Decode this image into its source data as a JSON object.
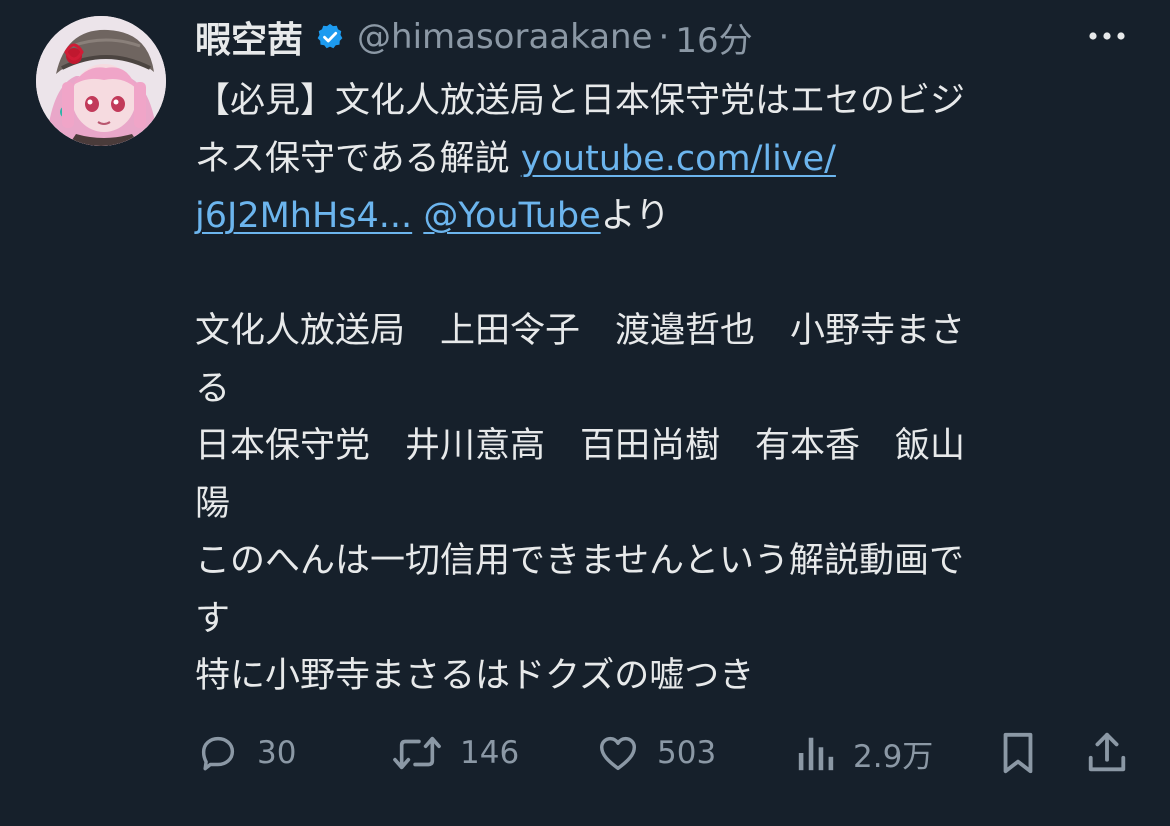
{
  "author": {
    "display_name": "暇空茜",
    "handle": "@himasoraakane",
    "separator": "·",
    "time": "16分",
    "verified_icon": "verified-badge-icon",
    "avatar": "avatar-image"
  },
  "tweet": {
    "line1": "【必見】文化人放送局と日本保守党はエセのビジ",
    "line2_text": "ネス保守である解説 ",
    "link1_part1": "youtube.com/live/",
    "link1_part2": "j6J2MhHs4...",
    "mention": "@YouTube",
    "line3_suffix": "より",
    "line4": "文化人放送局　上田令子　渡邉哲也　小野寺まさ",
    "line5": "る",
    "line6": "日本保守党　井川意高　百田尚樹　有本香　飯山",
    "line7": "陽",
    "line8": "このへんは一切信用できませんという解説動画で",
    "line9": "す",
    "line10": "特に小野寺まさるはドクズの嘘つき"
  },
  "actions": {
    "reply": {
      "icon": "reply-icon",
      "count": "30"
    },
    "retweet": {
      "icon": "retweet-icon",
      "count": "146"
    },
    "like": {
      "icon": "heart-icon",
      "count": "503"
    },
    "views": {
      "icon": "views-chart-icon",
      "count": "2.9万"
    },
    "bookmark": {
      "icon": "bookmark-icon"
    },
    "share": {
      "icon": "share-icon"
    }
  },
  "colors": {
    "background": "#16202b",
    "text": "#e7e9ea",
    "muted": "#8b98a5",
    "link": "#6cb5ee",
    "verified": "#1d9bf0"
  }
}
